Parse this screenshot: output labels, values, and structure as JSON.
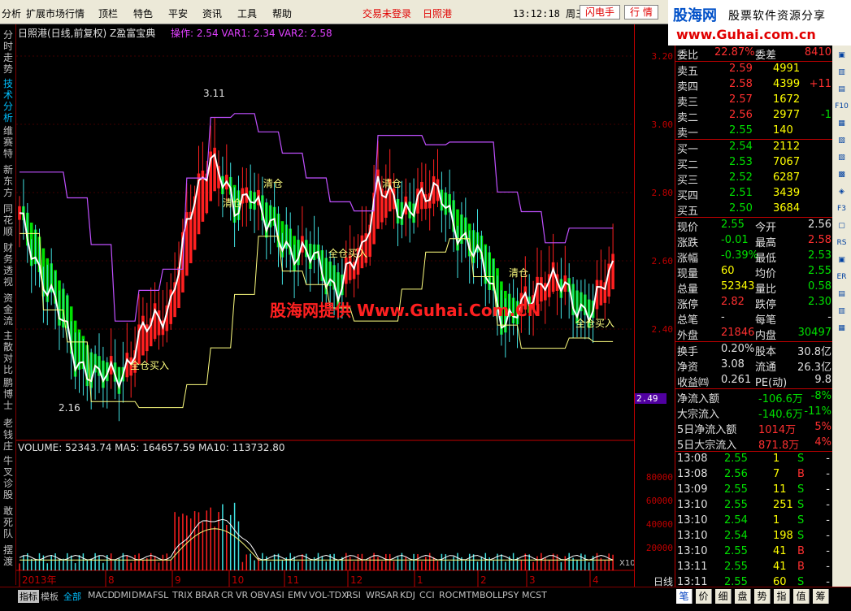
{
  "menu": [
    "分析",
    "扩展市场行情",
    "顶栏",
    "特色",
    "平安",
    "资讯",
    "工具",
    "帮助"
  ],
  "status_left": "交易未登录",
  "status_stock": "日照港",
  "clock": "13:12:18 周三",
  "top_buttons": [
    "闪电手",
    "行 情"
  ],
  "brand": {
    "logo": "股海网",
    "tagline": "股票软件资源分享",
    "url": "www.Guhai.com.cn"
  },
  "left_tabs": [
    {
      "label": "分时走势",
      "active": false
    },
    {
      "label": "技术分析",
      "active": true
    },
    {
      "label": "维赛特",
      "active": false
    },
    {
      "label": "新东方",
      "active": false
    },
    {
      "label": "同花顺",
      "active": false
    },
    {
      "label": "财务透视",
      "active": false
    },
    {
      "label": "资金流",
      "active": false
    },
    {
      "label": "主散对比",
      "active": false
    },
    {
      "label": "鹏博士",
      "active": false
    },
    {
      "label": "老钱庄",
      "active": false
    },
    {
      "label": "牛叉诊股",
      "active": false
    },
    {
      "label": "敢死队",
      "active": false
    },
    {
      "label": "摆渡",
      "active": false
    }
  ],
  "chart_header": {
    "title": "日照港(日线,前复权) Z盈富宝典",
    "indicators": "操作: 2.54  VAR1: 2.34  VAR2: 2.58"
  },
  "watermark": "股海网提供 Www.Guhai.Com.CN",
  "volume_header": "VOLUME: 52343.74  MA5: 164657.59  MA10: 113732.80",
  "x10_label": "X10",
  "price_axis": [
    "3.20",
    "3.00",
    "2.80",
    "2.60",
    "2.40"
  ],
  "volume_axis": [
    "80000",
    "60000",
    "40000",
    "20000"
  ],
  "price_marker": "2.49",
  "annotations": {
    "high": "3.11",
    "low": "2.16",
    "sell": "清仓",
    "buy": "全仓买入"
  },
  "x_axis_labels": [
    "2013年",
    "8",
    "9",
    "10",
    "11",
    "12",
    "1",
    "2",
    "3",
    "4"
  ],
  "period_label": "日线",
  "quote": {
    "weibi": {
      "label": "委比",
      "value": "22.87%",
      "label2": "委差",
      "value2": "8410"
    },
    "asks": [
      {
        "label": "卖五",
        "price": "2.59",
        "vol": "4991",
        "chg": ""
      },
      {
        "label": "卖四",
        "price": "2.58",
        "vol": "4399",
        "chg": "+11"
      },
      {
        "label": "卖三",
        "price": "2.57",
        "vol": "1672",
        "chg": ""
      },
      {
        "label": "卖二",
        "price": "2.56",
        "vol": "2977",
        "chg": "-1"
      },
      {
        "label": "卖一",
        "price": "2.55",
        "vol": "140",
        "chg": ""
      }
    ],
    "bids": [
      {
        "label": "买一",
        "price": "2.54",
        "vol": "2112"
      },
      {
        "label": "买二",
        "price": "2.53",
        "vol": "7067"
      },
      {
        "label": "买三",
        "price": "2.52",
        "vol": "6287"
      },
      {
        "label": "买四",
        "price": "2.51",
        "vol": "3439"
      },
      {
        "label": "买五",
        "price": "2.50",
        "vol": "3684"
      }
    ],
    "stats": [
      {
        "l1": "现价",
        "v1": "2.55",
        "c1": "c-g",
        "l2": "今开",
        "v2": "2.56",
        "c2": "c-w"
      },
      {
        "l1": "涨跌",
        "v1": "-0.01",
        "c1": "c-g",
        "l2": "最高",
        "v2": "2.58",
        "c2": "c-r"
      },
      {
        "l1": "涨幅",
        "v1": "-0.39%",
        "c1": "c-g",
        "l2": "最低",
        "v2": "2.53",
        "c2": "c-g"
      },
      {
        "l1": "现量",
        "v1": "60",
        "c1": "c-y",
        "l2": "均价",
        "v2": "2.55",
        "c2": "c-g"
      },
      {
        "l1": "总量",
        "v1": "52343",
        "c1": "c-y",
        "l2": "量比",
        "v2": "0.58",
        "c2": "c-g"
      },
      {
        "l1": "涨停",
        "v1": "2.82",
        "c1": "c-r",
        "l2": "跌停",
        "v2": "2.30",
        "c2": "c-g"
      },
      {
        "l1": "总笔",
        "v1": "-",
        "c1": "c-w",
        "l2": "每笔",
        "v2": "-",
        "c2": "c-w"
      },
      {
        "l1": "外盘",
        "v1": "21846",
        "c1": "c-r",
        "l2": "内盘",
        "v2": "30497",
        "c2": "c-g"
      }
    ],
    "fund": [
      {
        "l1": "换手",
        "v1": "0.20%",
        "l2": "股本",
        "v2": "30.8亿"
      },
      {
        "l1": "净资",
        "v1": "3.08",
        "l2": "流通",
        "v2": "26.3亿"
      },
      {
        "l1": "收益㈣",
        "v1": "0.261",
        "l2": "PE(动)",
        "v2": "9.8"
      }
    ],
    "flow": [
      {
        "label": "净流入额",
        "value": "-106.6万",
        "pct": "-8%",
        "color": "c-g"
      },
      {
        "label": "大宗流入",
        "value": "-140.6万",
        "pct": "-11%",
        "color": "c-g"
      },
      {
        "label": "5日净流入额",
        "value": "1014万",
        "pct": "5%",
        "color": "c-r"
      },
      {
        "label": "5日大宗流入",
        "value": "871.8万",
        "pct": "4%",
        "color": "c-r"
      }
    ],
    "ticks": [
      {
        "time": "13:08",
        "price": "2.55",
        "vol": "1",
        "side": "S",
        "extra": "-"
      },
      {
        "time": "13:08",
        "price": "2.56",
        "vol": "7",
        "side": "B",
        "extra": "-"
      },
      {
        "time": "13:09",
        "price": "2.55",
        "vol": "11",
        "side": "S",
        "extra": "-"
      },
      {
        "time": "13:10",
        "price": "2.55",
        "vol": "251",
        "side": "S",
        "extra": "-"
      },
      {
        "time": "13:10",
        "price": "2.54",
        "vol": "1",
        "side": "S",
        "extra": "-"
      },
      {
        "time": "13:10",
        "price": "2.54",
        "vol": "198",
        "side": "S",
        "extra": "-"
      },
      {
        "time": "13:10",
        "price": "2.55",
        "vol": "41",
        "side": "B",
        "extra": "-"
      },
      {
        "time": "13:11",
        "price": "2.55",
        "vol": "41",
        "side": "B",
        "extra": "-"
      },
      {
        "time": "13:11",
        "price": "2.55",
        "vol": "60",
        "side": "S",
        "extra": "-"
      }
    ]
  },
  "right_icons": [
    "▣",
    "▥",
    "▤",
    "F10",
    "▦",
    "▧",
    "▨",
    "▩",
    "◈",
    "F3",
    "▢",
    "RS",
    "▣",
    "ER",
    "▤",
    "▥",
    "▦"
  ],
  "bottom_tabs": [
    {
      "label": "指标",
      "cls": "dark"
    },
    {
      "label": "模板",
      "cls": ""
    },
    {
      "label": "全部",
      "cls": "active"
    },
    {
      "label": "MACD",
      "cls": ""
    },
    {
      "label": "DMI",
      "cls": ""
    },
    {
      "label": "DMA",
      "cls": ""
    },
    {
      "label": "FSL",
      "cls": ""
    },
    {
      "label": "TRIX",
      "cls": ""
    },
    {
      "label": "BRAR",
      "cls": ""
    },
    {
      "label": "CR",
      "cls": ""
    },
    {
      "label": "VR",
      "cls": ""
    },
    {
      "label": "OBV",
      "cls": ""
    },
    {
      "label": "ASI",
      "cls": ""
    },
    {
      "label": "EMV",
      "cls": ""
    },
    {
      "label": "VOL-TDX",
      "cls": ""
    },
    {
      "label": "RSI",
      "cls": ""
    },
    {
      "label": "WR",
      "cls": ""
    },
    {
      "label": "SAR",
      "cls": ""
    },
    {
      "label": "KDJ",
      "cls": ""
    },
    {
      "label": "CCI",
      "cls": ""
    },
    {
      "label": "ROC",
      "cls": ""
    },
    {
      "label": "MTM",
      "cls": ""
    },
    {
      "label": "BOLL",
      "cls": ""
    },
    {
      "label": "PSY",
      "cls": ""
    },
    {
      "label": "MCST",
      "cls": ""
    }
  ],
  "quote_tabs": [
    {
      "label": "笔",
      "active": true
    },
    {
      "label": "价",
      "active": false
    },
    {
      "label": "细",
      "active": false
    },
    {
      "label": "盘",
      "active": false
    },
    {
      "label": "势",
      "active": false
    },
    {
      "label": "指",
      "active": false
    },
    {
      "label": "值",
      "active": false
    },
    {
      "label": "筹",
      "active": false
    }
  ],
  "colors": {
    "up": "#ff2020",
    "down": "#00e000",
    "stop": "#c050ff",
    "support": "#ffff80",
    "ma": "#ffffff"
  }
}
